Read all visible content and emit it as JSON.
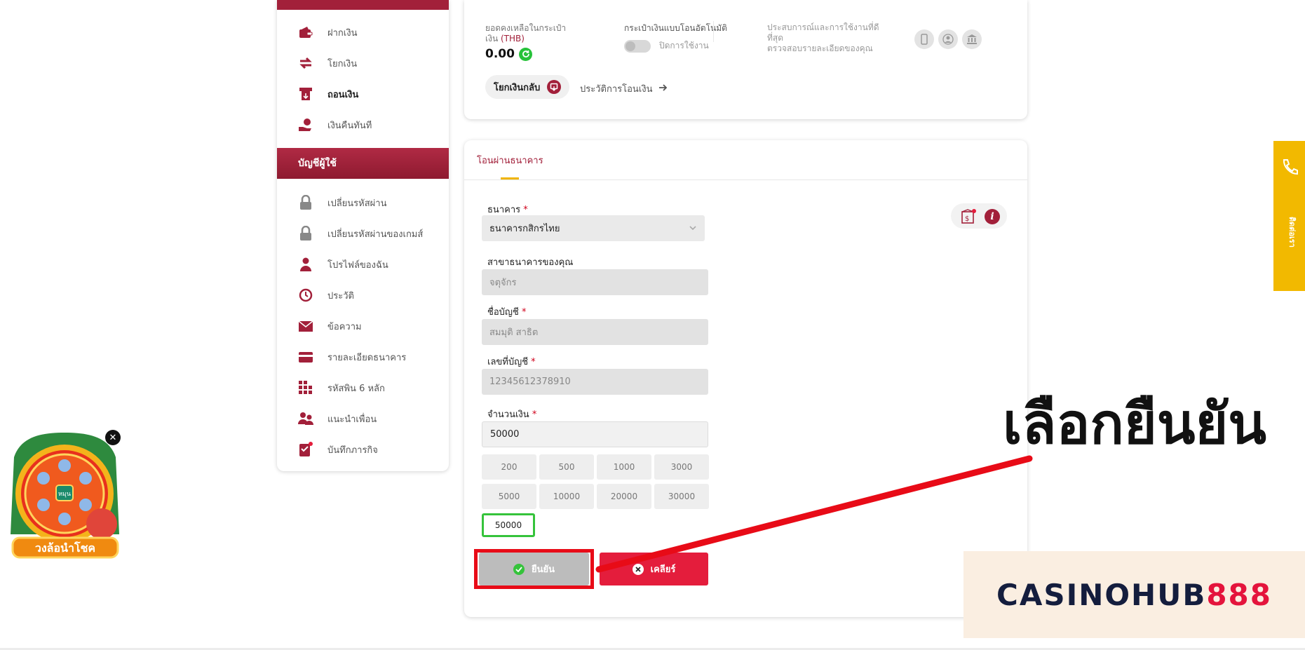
{
  "sidebar": {
    "wallet_items": [
      {
        "label": "ฝากเงิน",
        "icon": "wallet-icon"
      },
      {
        "label": "โยกเงิน",
        "icon": "transfer-icon"
      },
      {
        "label": "ถอนเงิน",
        "icon": "withdraw-icon"
      },
      {
        "label": "เงินคืนทันที",
        "icon": "cashback-icon"
      }
    ],
    "account_header": "บัญชีผู้ใช้",
    "account_items": [
      {
        "label": "เปลี่ยนรหัสผ่าน",
        "icon": "lock-icon"
      },
      {
        "label": "เปลี่ยนรหัสผ่านของเกมส์",
        "icon": "lock-icon"
      },
      {
        "label": "โปรไฟล์ของฉัน",
        "icon": "user-icon"
      },
      {
        "label": "ประวัติ",
        "icon": "history-icon"
      },
      {
        "label": "ข้อความ",
        "icon": "mail-icon"
      },
      {
        "label": "รายละเอียดธนาคาร",
        "icon": "card-icon"
      },
      {
        "label": "รหัสพิน 6 หลัก",
        "icon": "keypad-icon"
      },
      {
        "label": "แนะนำเพื่อน",
        "icon": "referral-icon"
      },
      {
        "label": "บันทึกภารกิจ",
        "icon": "mission-icon"
      }
    ]
  },
  "wallet": {
    "balance_label_1": "ยอดคงเหลือในกระเป๋า",
    "balance_label_2": "เงิน ",
    "currency": "(THB)",
    "balance": "0.00",
    "auto_transfer_label": "กระเป๋าเงินแบบโอนอัตโนมัติ",
    "auto_transfer_status": "ปิดการใช้งาน",
    "experience_1": "ประสบการณ์และการใช้งานที่ดี",
    "experience_2": "ที่สุด",
    "experience_3": "ตรวจสอบรายละเอียดของคุณ",
    "restore_button": "โยกเงินกลับ",
    "transfer_history": "ประวัติการโอนเงิน"
  },
  "form": {
    "tab": "โอนผ่านธนาคาร",
    "bank_label": "ธนาคาร",
    "bank_value": "ธนาคารกสิกรไทย",
    "branch_label": "สาขาธนาคารของคุณ",
    "branch_value": "จตุจักร",
    "account_name_label": "ชื่อบัญชี",
    "account_name_value": "สมมุติ สาธิต",
    "account_number_label": "เลขที่บัญชี",
    "account_number_value": "12345612378910",
    "amount_label": "จำนวนเงิน",
    "amount_value": "50000",
    "required_mark": "*",
    "amount_chips": [
      "200",
      "500",
      "1000",
      "3000",
      "5000",
      "10000",
      "20000",
      "30000"
    ],
    "selected_chip": "50000",
    "confirm_button": "ยืนยัน",
    "clear_button": "เคลียร์"
  },
  "annotation": {
    "text": "เลือกยืนยัน",
    "color": "#e80b17"
  },
  "side_tab": {
    "label": "ติดต่อเรา"
  },
  "wheel": {
    "label": "วงล้อนำโชค",
    "center": "หมุน",
    "close": "✕"
  },
  "watermark": {
    "part1": "CASINOHUB",
    "part2": "888"
  },
  "colors": {
    "primary": "#a2203a",
    "accent": "#f2b900",
    "confirm_highlight": "#35c33b",
    "clear": "#e41d3c"
  }
}
